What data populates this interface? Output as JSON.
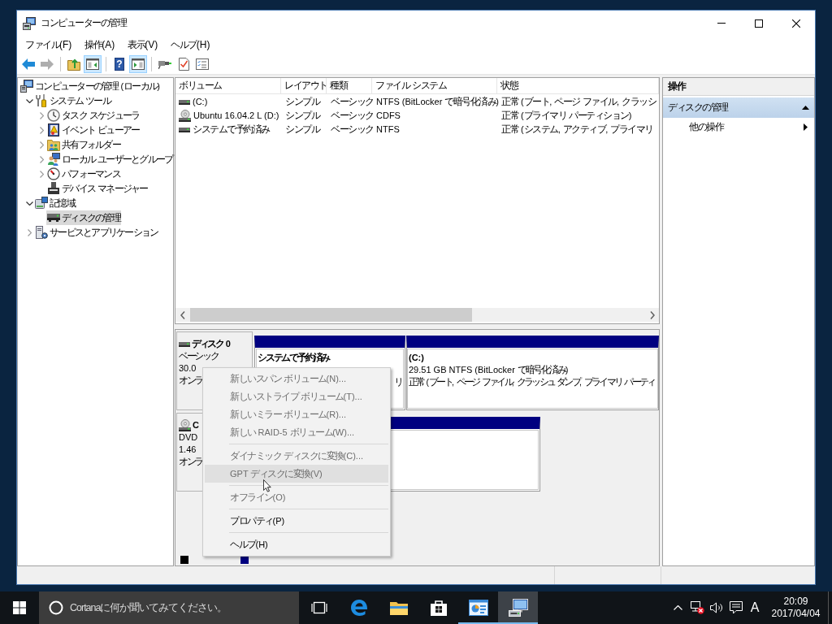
{
  "window": {
    "title": "コンピューターの管理"
  },
  "menu_bar": [
    {
      "label": "ファイル(F)"
    },
    {
      "label": "操作(A)"
    },
    {
      "label": "表示(V)"
    },
    {
      "label": "ヘルプ(H)"
    }
  ],
  "toolbar": [
    {
      "kind": "back",
      "disabled": false
    },
    {
      "kind": "forward",
      "disabled": true
    },
    {
      "kind": "separator"
    },
    {
      "kind": "up-folder",
      "disabled": false
    },
    {
      "kind": "console-tree",
      "on": true,
      "disabled": false
    },
    {
      "kind": "separator"
    },
    {
      "kind": "help",
      "glyph": "?",
      "disabled": false
    },
    {
      "kind": "action-pane",
      "on": true,
      "disabled": false
    },
    {
      "kind": "separator"
    },
    {
      "kind": "connect",
      "disabled": false
    },
    {
      "kind": "check-page",
      "disabled": false
    },
    {
      "kind": "checklist",
      "disabled": false
    }
  ],
  "tree": {
    "items": [
      {
        "kind": "computer",
        "label": "コンピューターの管理 (ローカル)",
        "selected": false,
        "children": [
          {
            "kind": "tools",
            "label": "システム ツール",
            "expanded": true,
            "selected": false,
            "children": [
              {
                "kind": "clock",
                "label": "タスク スケジューラ",
                "expanded": false,
                "selected": false
              },
              {
                "kind": "event-log",
                "label": "イベント ビューアー",
                "expanded": false,
                "selected": false
              },
              {
                "kind": "shared-folder",
                "label": "共有フォルダー",
                "expanded": false,
                "selected": false
              },
              {
                "kind": "users",
                "label": "ローカル ユーザーとグループ",
                "expanded": false,
                "selected": false
              },
              {
                "kind": "performance",
                "label": "パフォーマンス",
                "expanded": false,
                "selected": false
              },
              {
                "kind": "device-manager",
                "label": "デバイス マネージャー",
                "selected": false
              }
            ]
          },
          {
            "kind": "storage",
            "label": "記憶域",
            "expanded": true,
            "selected": false,
            "children": [
              {
                "kind": "disk",
                "label": "ディスクの管理",
                "selected": true
              }
            ]
          },
          {
            "kind": "services",
            "label": "サービスとアプリケーション",
            "expanded": false,
            "selected": false
          }
        ]
      }
    ]
  },
  "volume_list": {
    "columns": [
      "ボリューム",
      "レイアウト",
      "種類",
      "ファイル システム",
      "状態"
    ],
    "rows": [
      {
        "kind": "disk",
        "cells": [
          "(C:)",
          "シンプル",
          "ベーシック",
          "NTFS (BitLocker で暗号化済み)",
          "正常 (ブート, ページ ファイル, クラッシ"
        ]
      },
      {
        "kind": "cd",
        "cells": [
          "Ubuntu 16.04.2 L (D:)",
          "シンプル",
          "ベーシック",
          "CDFS",
          "正常 (プライマリ パーティション)"
        ]
      },
      {
        "kind": "disk",
        "cells": [
          "システムで予約済み",
          "シンプル",
          "ベーシック",
          "NTFS",
          "正常 (システム, アクティブ, プライマリ"
        ]
      }
    ]
  },
  "disk_map": {
    "disks": [
      {
        "kind": "disk",
        "name": "ディスク 0",
        "type": "ベーシック",
        "size": "30.0",
        "status": "オンラ",
        "partitions": [
          {
            "kind": "primary",
            "name": "システムで予約済み",
            "status_tail": "リ"
          },
          {
            "kind": "primary",
            "name": "(C:)",
            "size": "29.51 GB NTFS (BitLocker で暗号化済み)",
            "status": "正常 (ブート, ページ ファイル, クラッシュ ダンプ, プライマリ パーティ"
          }
        ]
      },
      {
        "kind": "cd",
        "name": "C",
        "type": "DVD",
        "size": "1.46",
        "status": "オンラ",
        "partitions": [
          {
            "kind": "primary"
          }
        ]
      }
    ],
    "legend": [
      {
        "color": "#000000"
      },
      {
        "color": "#000080"
      }
    ]
  },
  "context_menu": {
    "items": [
      {
        "kind": "item",
        "label": "新しいスパン ボリューム(N)...",
        "disabled": true,
        "selected": false
      },
      {
        "kind": "item",
        "label": "新しいストライプ ボリューム(T)...",
        "disabled": true,
        "selected": false
      },
      {
        "kind": "item",
        "label": "新しいミラー ボリューム(R)...",
        "disabled": true,
        "selected": false
      },
      {
        "kind": "item",
        "label": "新しい RAID-5 ボリューム(W)...",
        "disabled": true,
        "selected": false
      },
      {
        "kind": "separator"
      },
      {
        "kind": "item",
        "label": "ダイナミック ディスクに変換(C)...",
        "disabled": true,
        "selected": false
      },
      {
        "kind": "item",
        "label": "GPT ディスクに変換(V)",
        "disabled": true,
        "selected": true
      },
      {
        "kind": "separator"
      },
      {
        "kind": "item",
        "label": "オフライン(O)",
        "disabled": true,
        "selected": false
      },
      {
        "kind": "separator"
      },
      {
        "kind": "item",
        "label": "プロパティ(P)",
        "disabled": false,
        "selected": false
      },
      {
        "kind": "separator"
      },
      {
        "kind": "item",
        "label": "ヘルプ(H)",
        "disabled": false,
        "selected": false
      }
    ]
  },
  "action_pane": {
    "title": "操作",
    "sections": [
      {
        "title": "ディスクの管理",
        "expanded": true,
        "actions": [
          {
            "kind": "submenu",
            "label": "他の操作"
          }
        ]
      }
    ]
  },
  "taskbar": {
    "search": {
      "placeholder": "Cortanaに何か聞いてみてください。"
    },
    "apps": [
      {
        "kind": "task-view",
        "running": false,
        "selected": false
      },
      {
        "kind": "browser",
        "running": false,
        "selected": false
      },
      {
        "kind": "explorer",
        "running": false,
        "selected": false
      },
      {
        "kind": "store",
        "running": false,
        "selected": false
      },
      {
        "kind": "chart-window",
        "running": true,
        "selected": false
      },
      {
        "kind": "computer",
        "running": true,
        "selected": true
      }
    ],
    "input_indicator": "A",
    "clock": {
      "time": "20:09",
      "date": "2017/04/04"
    }
  }
}
